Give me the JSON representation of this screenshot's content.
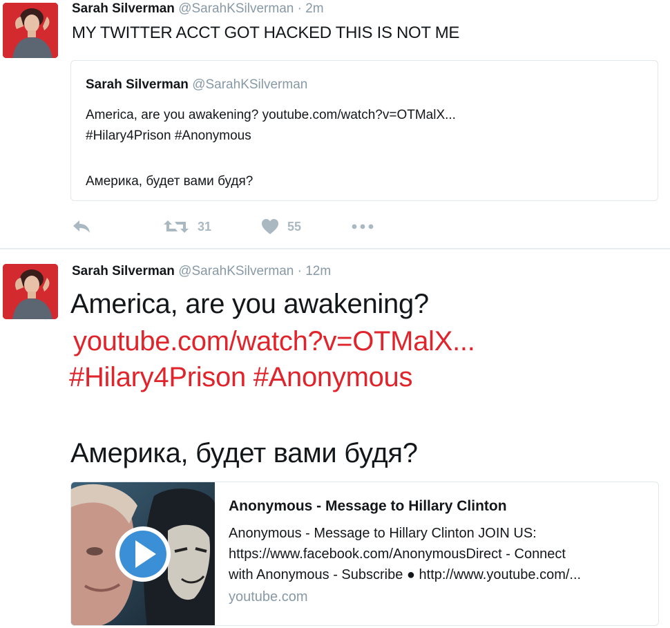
{
  "tweet1": {
    "author_name": "Sarah Silverman",
    "author_handle": "@SarahKSilverman",
    "separator": "·",
    "time": "2m",
    "text": "MY TWITTER ACCT GOT HACKED THIS IS NOT ME",
    "quoted": {
      "author_name": "Sarah Silverman",
      "author_handle": "@SarahKSilverman",
      "line1": "America, are you awakening? youtube.com/watch?v=OTMalX...",
      "line2": "#Hilary4Prison #Anonymous",
      "line3": "Америка, будет вами будя?"
    },
    "actions": {
      "reply_icon": "reply-icon",
      "retweet_icon": "retweet-icon",
      "retweet_count": "31",
      "like_icon": "heart-icon",
      "like_count": "55",
      "more_icon": "more-dots-icon"
    }
  },
  "tweet2": {
    "author_name": "Sarah Silverman",
    "author_handle": "@SarahKSilverman",
    "separator": "·",
    "time": "12m",
    "text_line1": "America, are you awakening?",
    "link": "youtube.com/watch?v=OTMalX...",
    "hashtags": "#Hilary4Prison #Anonymous",
    "text_ru": "Америка, будет вами будя?",
    "card": {
      "thumbnail_icon": "play-button-icon",
      "title": "Anonymous - Message to Hillary Clinton",
      "desc_line1": "Anonymous - Message to Hillary Clinton JOIN US:",
      "desc_line2": "https://www.facebook.com/AnonymousDirect - Connect",
      "desc_line3": "with Anonymous - Subscribe ● http://www.youtube.com/...",
      "domain": "youtube.com"
    }
  },
  "colors": {
    "link": "#e0242b",
    "muted": "#8899a6",
    "action_icon": "#aab8c2",
    "border": "#e1e8ed"
  }
}
